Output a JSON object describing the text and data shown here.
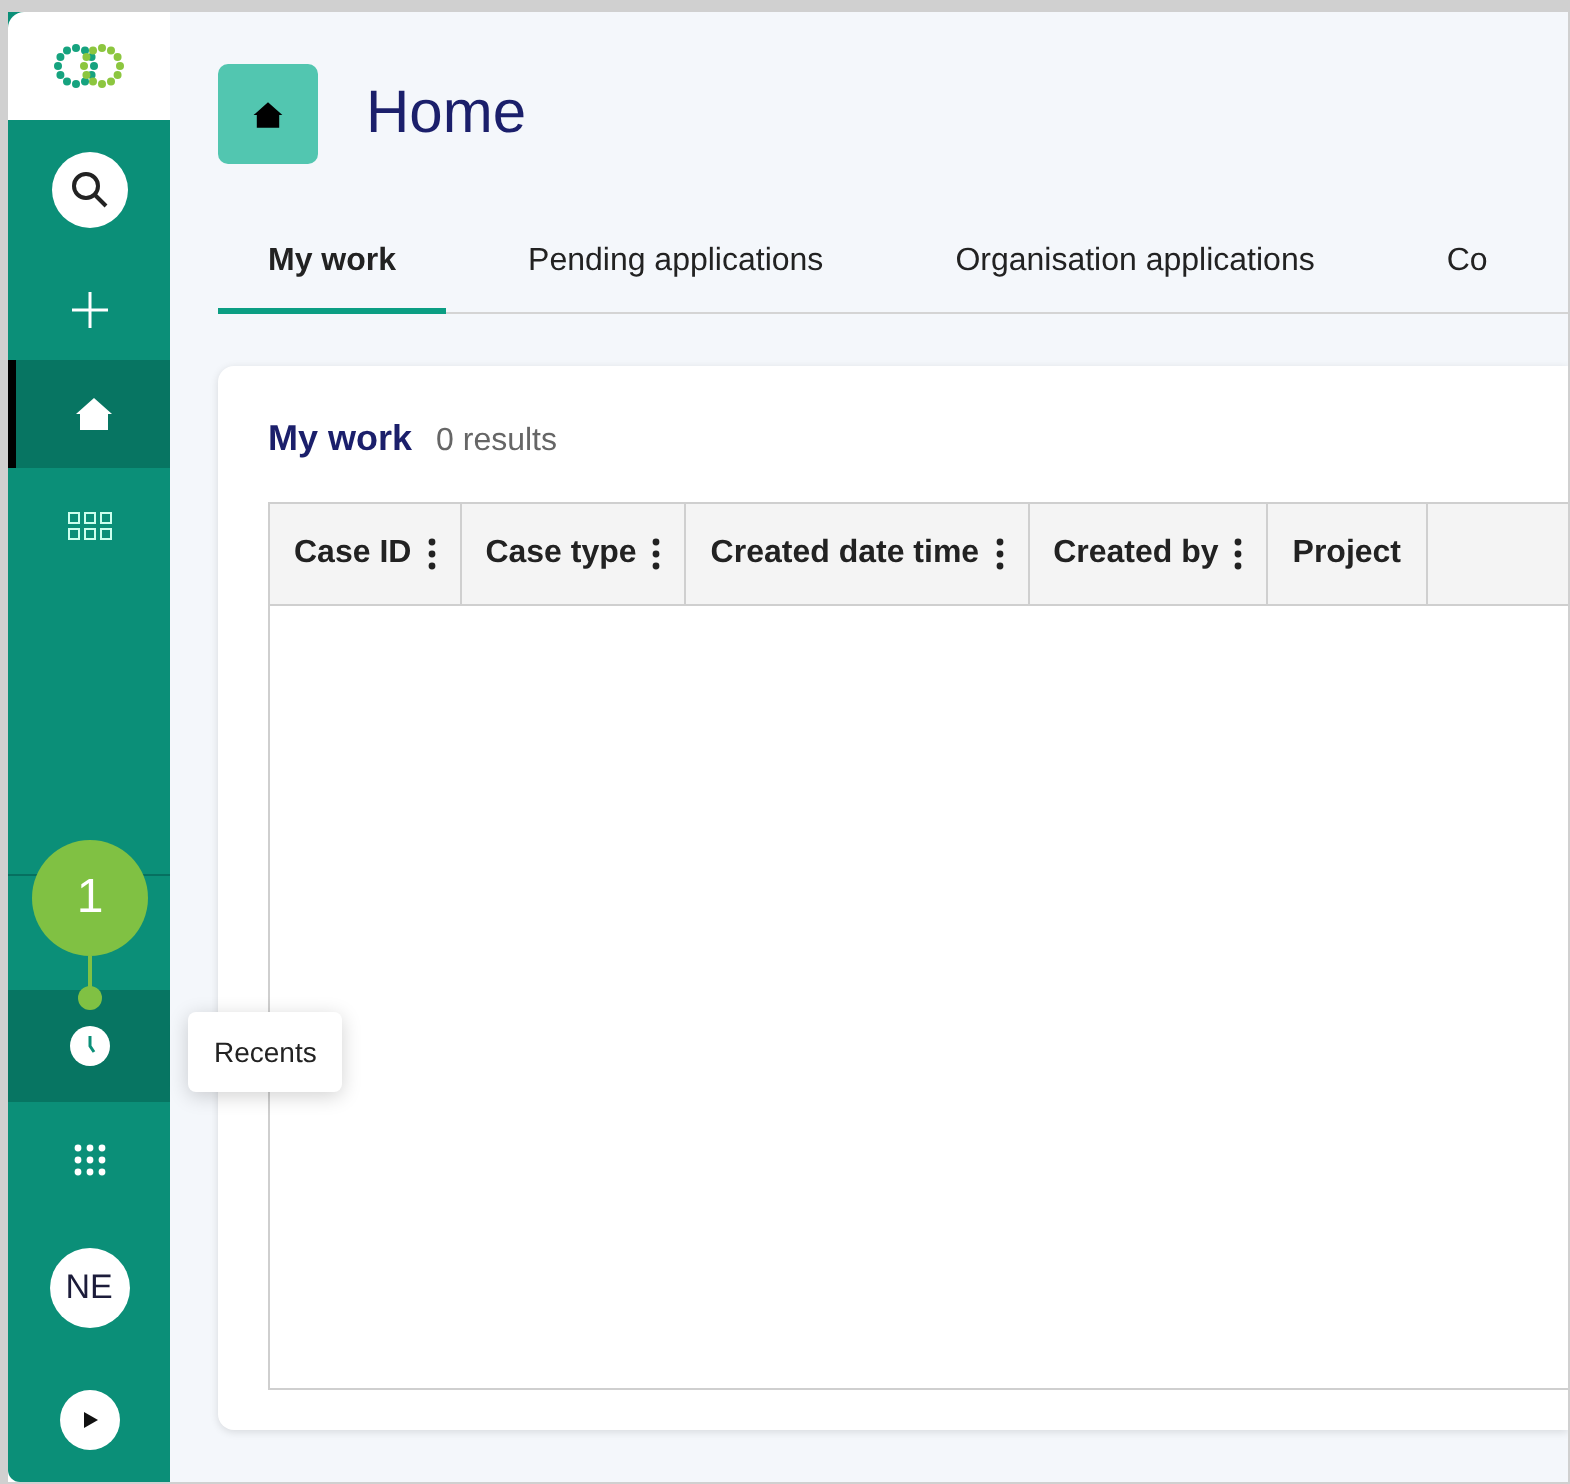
{
  "sidebar": {
    "items": [
      {
        "kind": "search",
        "selected": false
      },
      {
        "kind": "plus",
        "selected": false
      },
      {
        "kind": "home",
        "selected": true
      },
      {
        "kind": "grid",
        "selected": false
      }
    ],
    "bottom_items": [
      {
        "kind": "clock",
        "selected": true,
        "tooltip": "Recents"
      },
      {
        "kind": "dots",
        "selected": false
      },
      {
        "kind": "avatar",
        "label": "NE",
        "selected": false
      },
      {
        "kind": "play",
        "selected": false
      }
    ]
  },
  "callout": {
    "label": "1"
  },
  "header": {
    "title": "Home"
  },
  "tabs": [
    {
      "label": "My work",
      "selected": true
    },
    {
      "label": "Pending applications",
      "selected": false
    },
    {
      "label": "Organisation applications",
      "selected": false
    },
    {
      "label": "Co",
      "selected": false
    }
  ],
  "card": {
    "title": "My work",
    "count": "0 results"
  },
  "table": {
    "columns": [
      "Case ID",
      "Case type",
      "Created date time",
      "Created by",
      "Project"
    ]
  }
}
